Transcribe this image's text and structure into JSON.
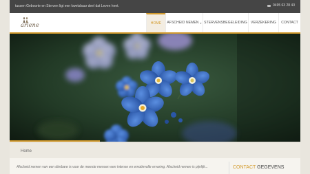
{
  "topbar": {
    "tagline": "tussen Geboorte en Sterven ligt een kwetsbaar deel dat Leven heet.",
    "phone": "0495 63 28 40",
    "phone_icon": "phone-icon"
  },
  "brand": {
    "logo_text": "arlene",
    "logo_icon": "people-silhouette-icon"
  },
  "nav": {
    "items": [
      {
        "label": "HOME",
        "active": true
      },
      {
        "label": "AFSCHEID NEMEN",
        "has_dropdown": true
      },
      {
        "label": "STERVENSBEGELEIDING"
      },
      {
        "label": "VERZEKERING"
      },
      {
        "label": "CONTACT"
      }
    ]
  },
  "hero": {
    "image": "forget-me-not-flowers",
    "slider_progress": 0.31
  },
  "breadcrumb": {
    "current": "Home"
  },
  "content": {
    "intro": "Afscheid nemen van een dierbare is voor de meeste mensen een intense en emotievolle ervaring. Afscheid nemen is pijnlijk...",
    "sidebar_title_accent": "CONTACT",
    "sidebar_title_rest": "GEGEVENS"
  },
  "colors": {
    "accent": "#d39b2d",
    "topbar": "#454545",
    "flower_blue": "#2f62b9"
  }
}
